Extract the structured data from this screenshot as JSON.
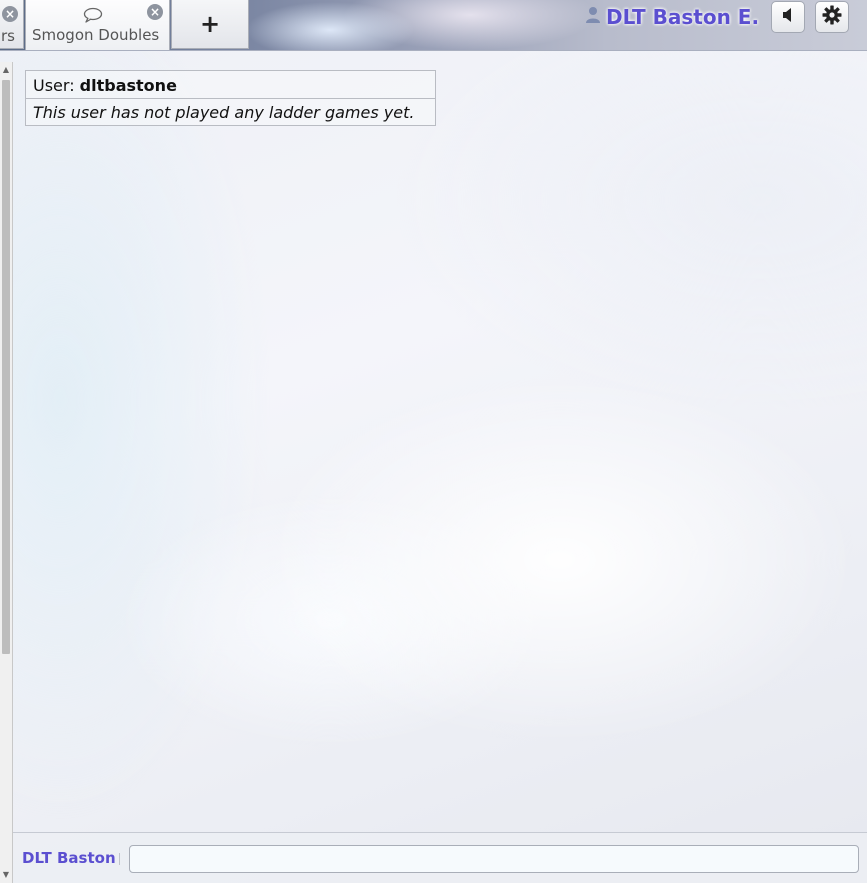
{
  "tabs": [
    {
      "label": "rs",
      "closable": true
    },
    {
      "label": "Smogon Doubles",
      "closable": true,
      "active": true
    }
  ],
  "new_tab_label": "+",
  "header": {
    "username": "DLT Baston E."
  },
  "user_box": {
    "user_label": "User:",
    "user_name": "dltbastone",
    "note": "This user has not played any ladder games yet."
  },
  "chat": {
    "name": "DLT Baston",
    "input_value": ""
  },
  "colors": {
    "username": "#5b4fd0",
    "tab_bg": "#eef0f3"
  }
}
